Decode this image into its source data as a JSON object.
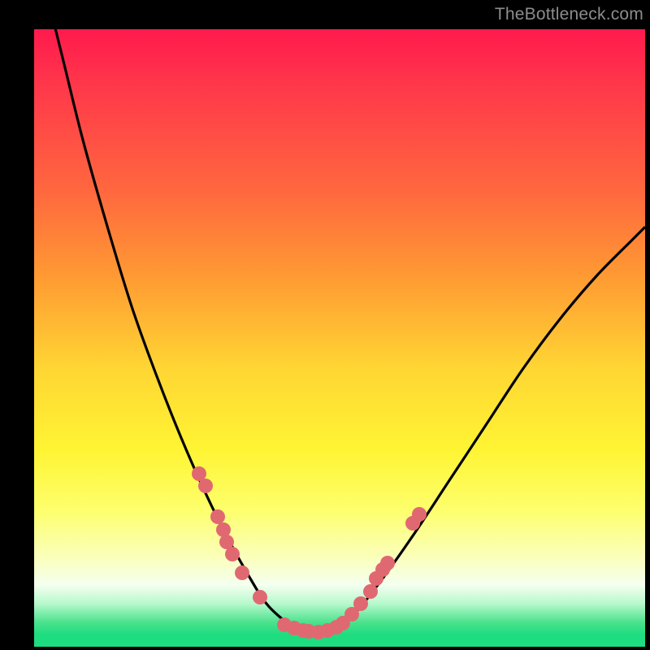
{
  "watermark": "TheBottleneck.com",
  "colors": {
    "background_frame": "#000000",
    "gradient_top": "#ff1a4d",
    "gradient_mid": "#fff433",
    "gradient_bottom": "#1edc80",
    "curve": "#000000",
    "points": "#e06971"
  },
  "chart_data": {
    "type": "line",
    "title": "",
    "xlabel": "",
    "ylabel": "",
    "xlim": [
      0,
      100
    ],
    "ylim": [
      0,
      100
    ],
    "series": [
      {
        "name": "curve",
        "x": [
          3,
          5,
          8,
          12,
          16,
          20,
          24,
          28,
          32,
          36,
          38,
          40,
          42,
          44,
          46,
          48,
          50,
          53,
          57,
          62,
          68,
          74,
          80,
          86,
          92,
          98,
          100
        ],
        "y": [
          102,
          94,
          82,
          68,
          55,
          44,
          34,
          25,
          17,
          10,
          7,
          5,
          3.5,
          2.5,
          2.2,
          2.5,
          3.5,
          6,
          11,
          18,
          27,
          36,
          45,
          53,
          60,
          66,
          68
        ]
      }
    ],
    "points": [
      {
        "x": 27,
        "y": 28
      },
      {
        "x": 28,
        "y": 26
      },
      {
        "x": 30,
        "y": 21
      },
      {
        "x": 31,
        "y": 19
      },
      {
        "x": 31.5,
        "y": 17
      },
      {
        "x": 32.5,
        "y": 15
      },
      {
        "x": 34,
        "y": 12
      },
      {
        "x": 37,
        "y": 8
      },
      {
        "x": 41,
        "y": 3.6
      },
      {
        "x": 42.5,
        "y": 3.0
      },
      {
        "x": 44,
        "y": 2.6
      },
      {
        "x": 45,
        "y": 2.5
      },
      {
        "x": 46.5,
        "y": 2.4
      },
      {
        "x": 48,
        "y": 2.6
      },
      {
        "x": 49.5,
        "y": 3.2
      },
      {
        "x": 50.5,
        "y": 3.8
      },
      {
        "x": 52,
        "y": 5.2
      },
      {
        "x": 53.5,
        "y": 7
      },
      {
        "x": 55,
        "y": 9
      },
      {
        "x": 56,
        "y": 11
      },
      {
        "x": 57,
        "y": 12.5
      },
      {
        "x": 57.8,
        "y": 13.5
      },
      {
        "x": 62,
        "y": 20
      },
      {
        "x": 63,
        "y": 21.5
      }
    ]
  }
}
